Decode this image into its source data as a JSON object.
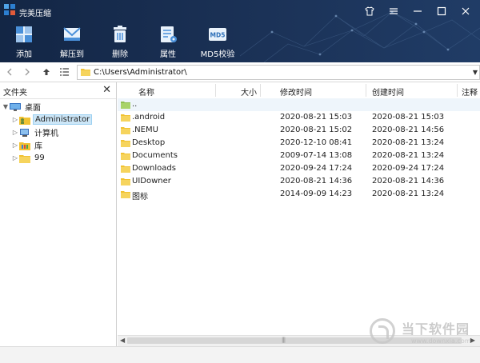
{
  "app": {
    "title": "完美压缩"
  },
  "window_controls": {
    "skin": "T",
    "menu": "≡",
    "minimize": "—",
    "maximize": "☐",
    "close": "✕"
  },
  "toolbar": [
    {
      "label": "添加",
      "icon": "add-icon"
    },
    {
      "label": "解压到",
      "icon": "extract-envelope-icon"
    },
    {
      "label": "删除",
      "icon": "trash-icon"
    },
    {
      "label": "属性",
      "icon": "properties-icon"
    },
    {
      "label": "MD5校验",
      "icon": "md5-icon",
      "badge": "MD5"
    }
  ],
  "address": {
    "path": "C:\\Users\\Administrator\\"
  },
  "left_panel": {
    "title": "文件夹",
    "close": "✕",
    "tree": [
      {
        "label": "桌面",
        "icon": "desktop-icon",
        "expanded": true
      },
      {
        "label": "Administrator",
        "icon": "user-folder-icon",
        "selected": true
      },
      {
        "label": "计算机",
        "icon": "computer-icon"
      },
      {
        "label": "库",
        "icon": "library-icon"
      },
      {
        "label": "99",
        "icon": "folder-icon"
      }
    ]
  },
  "columns": {
    "name": "名称",
    "size": "大小",
    "modified": "修改时间",
    "created": "创建时间",
    "note": "注释"
  },
  "parent_entry": "..",
  "files": [
    {
      "name": ".android",
      "modified": "2020-08-21 15:03",
      "created": "2020-08-21 15:03"
    },
    {
      "name": ".NEMU",
      "modified": "2020-08-21 15:02",
      "created": "2020-08-21 14:56"
    },
    {
      "name": "Desktop",
      "modified": "2020-12-10 08:41",
      "created": "2020-08-21 13:24"
    },
    {
      "name": "Documents",
      "modified": "2009-07-14 13:08",
      "created": "2020-08-21 13:24"
    },
    {
      "name": "Downloads",
      "modified": "2020-09-24 17:24",
      "created": "2020-09-24 17:24"
    },
    {
      "name": "UIDowner",
      "modified": "2020-08-21 14:36",
      "created": "2020-08-21 14:36"
    },
    {
      "name": "图标",
      "modified": "2014-09-09 14:23",
      "created": "2020-08-21 13:24"
    }
  ],
  "scrollbar": {
    "left": "◀",
    "right": "▶",
    "grip": "|||"
  },
  "watermark": {
    "text": "当下软件园",
    "url": "www.downxia.com"
  },
  "colors": {
    "header_bg": "#1b3257",
    "folder": "#f1c232",
    "selection": "#cce6f7"
  }
}
